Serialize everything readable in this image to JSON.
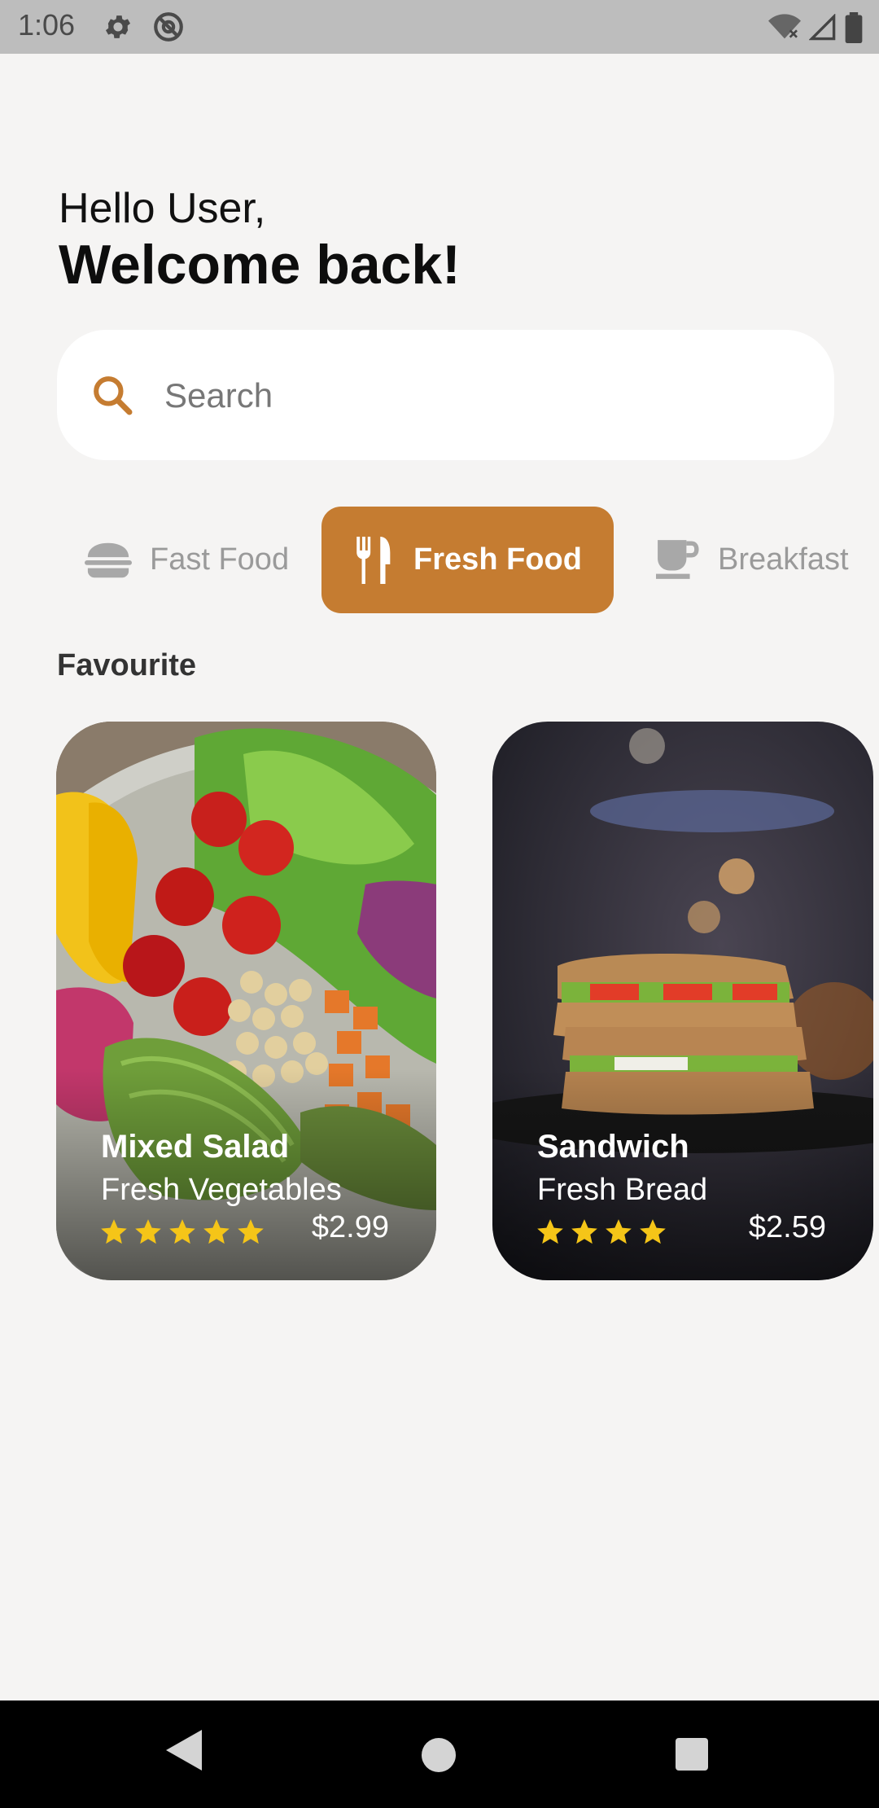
{
  "status_bar": {
    "time": "1:06",
    "icons": [
      "gear-icon",
      "at-sign-icon",
      "wifi-off-icon",
      "signal-icon",
      "battery-icon"
    ]
  },
  "header": {
    "greeting": "Hello User,",
    "welcome": "Welcome back!"
  },
  "search": {
    "placeholder": "Search",
    "value": "",
    "icon": "search-icon"
  },
  "categories": [
    {
      "label": "Fast Food",
      "icon": "burger-icon",
      "selected": false
    },
    {
      "label": "Fresh Food",
      "icon": "fork-knife-icon",
      "selected": true
    },
    {
      "label": "Breakfast",
      "icon": "coffee-cup-icon",
      "selected": false
    }
  ],
  "favourite": {
    "title": "Favourite",
    "items": [
      {
        "name": "Mixed Salad",
        "subtitle": "Fresh Vegetables",
        "rating": 5,
        "price": "$2.99"
      },
      {
        "name": "Sandwich",
        "subtitle": "Fresh Bread",
        "rating": 4,
        "price": "$2.59"
      }
    ]
  },
  "colors": {
    "accent": "#c57c31",
    "background": "#f5f4f3",
    "star": "#f5c518"
  },
  "nav_bar": {
    "icons": [
      "back-icon",
      "home-icon",
      "recents-icon"
    ]
  }
}
